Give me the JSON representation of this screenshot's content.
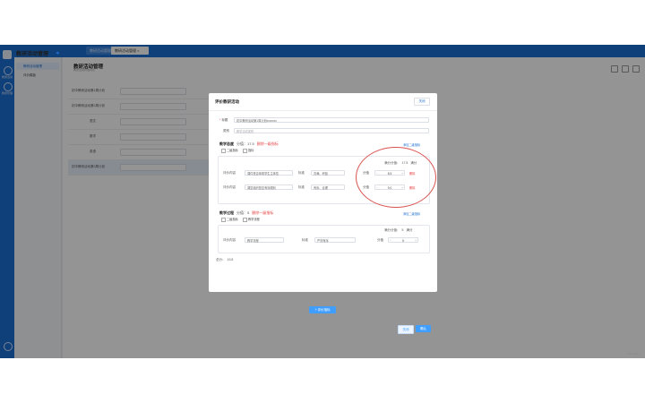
{
  "app": {
    "title": "教研活动管理"
  },
  "tabs": [
    {
      "label": "教研活动管理"
    },
    {
      "label": "教研活动管理 ×"
    }
  ],
  "sidebar": {
    "nav_labels": [
      "教研活动",
      "教研管理"
    ],
    "items": [
      {
        "label": "教研活动管理"
      },
      {
        "label": "评价模板"
      }
    ]
  },
  "page": {
    "title": "教研活动管理",
    "subtitle": "教研活动管理列表"
  },
  "background_table": {
    "rows": [
      {
        "label": "初中教研活动第1周计划"
      },
      {
        "label": "初中教研活动第2周计划"
      },
      {
        "label": "语文"
      },
      {
        "label": "数学"
      },
      {
        "label": "英语"
      },
      {
        "label": "初中教研活动第3周计划"
      }
    ]
  },
  "modal": {
    "title": "评价教研活动",
    "close_label": "关闭",
    "fields": {
      "title_label": "标题",
      "title_value": "初中教研活动第1周计划xxxxxxx",
      "category_label": "类别",
      "category_placeholder": "教学活动类别"
    },
    "section1": {
      "title": "教学态度",
      "count": "分值：17.5",
      "delete": "删除一级指标",
      "add_link": "添加二级指标",
      "checkbox_a": "二级指标",
      "checkbox_b": "指标",
      "total_label": "满分分值：",
      "total_value": "17.5",
      "total_unit": "满分",
      "rows": [
        {
          "content_label": "评价内容",
          "content_value": "课件是否体现学生主体性",
          "standard_label": "标准",
          "standard_value": "充满、积极",
          "score_label": "分值",
          "score_value": "8.5",
          "delete": "删除"
        },
        {
          "content_label": "评价内容",
          "content_value": "课堂组织是否有序顺利",
          "standard_label": "标准",
          "standard_value": "有序、合理",
          "score_label": "分值",
          "score_value": "9.0",
          "delete": "删除"
        }
      ]
    },
    "section2": {
      "title": "教学过程",
      "count": "分值：5",
      "delete": "删除一级指标",
      "add_link": "添加二级指标",
      "checkbox_a": "二级指标",
      "checkbox_b": "教学流程",
      "total_label": "满分分值：",
      "total_value": "5",
      "total_unit": "满分",
      "rows": [
        {
          "content_label": "评价内容",
          "content_value": "教学流程",
          "standard_label": "标准",
          "standard_value": "严谨有序",
          "score_label": "分值",
          "score_value": "5"
        }
      ]
    },
    "total": {
      "label": "总分：",
      "value": "19.5"
    },
    "add_button": "+ 评价指标",
    "cancel": "关闭",
    "ok": "确认"
  },
  "statusbar": {
    "text": "REC 2021"
  }
}
